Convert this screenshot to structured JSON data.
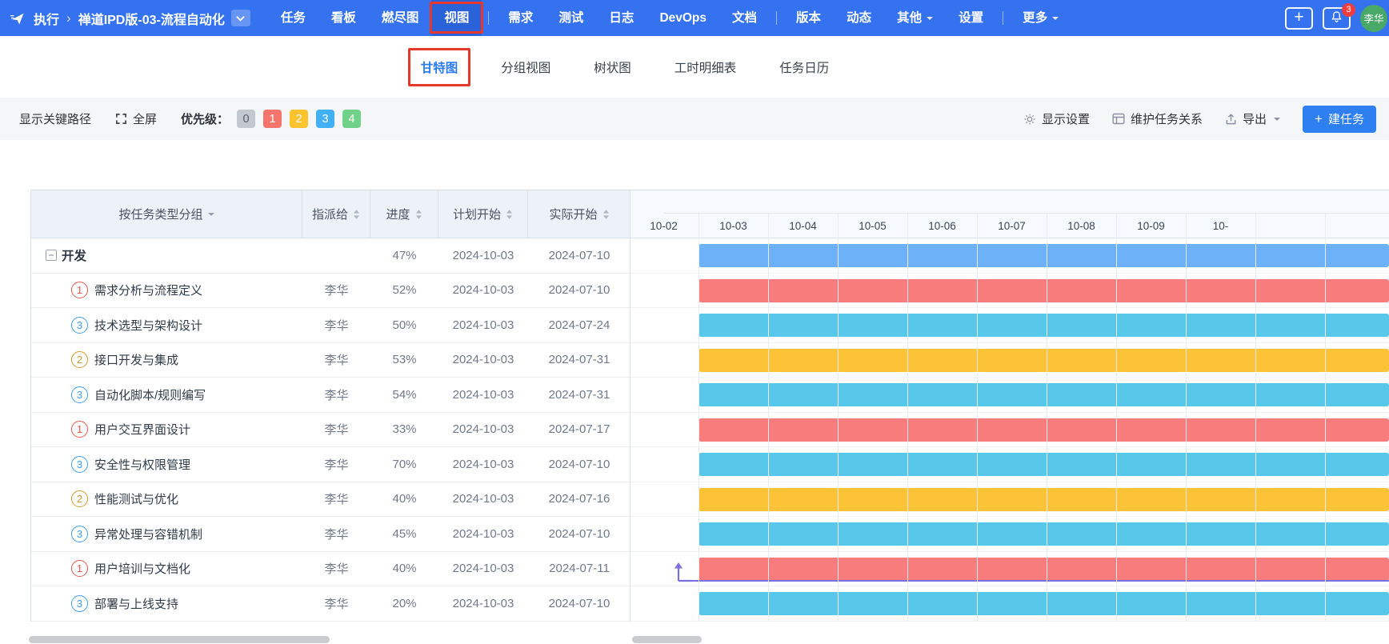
{
  "navbar": {
    "breadcrumb": {
      "section": "执行",
      "separator": "›",
      "project": "禅道IPD版-03-流程自动化"
    },
    "menu": [
      {
        "label": "任务"
      },
      {
        "label": "看板"
      },
      {
        "label": "燃尽图"
      },
      {
        "label": "视图",
        "active": true
      },
      {
        "divider": true
      },
      {
        "label": "需求"
      },
      {
        "label": "测试"
      },
      {
        "label": "日志"
      },
      {
        "label": "DevOps"
      },
      {
        "label": "文档"
      },
      {
        "divider": true
      },
      {
        "label": "版本"
      },
      {
        "label": "动态"
      },
      {
        "label": "其他",
        "caret": true
      },
      {
        "label": "设置"
      },
      {
        "divider": true
      },
      {
        "label": "更多",
        "caret": true
      }
    ],
    "plus_icon": "+",
    "notification_count": "3",
    "avatar_name": "李华"
  },
  "tabs": [
    {
      "label": "甘特图",
      "active": true
    },
    {
      "label": "分组视图"
    },
    {
      "label": "树状图"
    },
    {
      "label": "工时明细表"
    },
    {
      "label": "任务日历"
    }
  ],
  "toolbar": {
    "show_critical_path": "显示关键路径",
    "fullscreen": "全屏",
    "priority_label": "优先级：",
    "priorities": [
      {
        "label": "0",
        "bg": "#c2c7d0",
        "fg": "#595f6b"
      },
      {
        "label": "1",
        "bg": "#f3756c",
        "fg": "#ffffff"
      },
      {
        "label": "2",
        "bg": "#fcc32f",
        "fg": "#ffffff"
      },
      {
        "label": "3",
        "bg": "#41b0f5",
        "fg": "#ffffff"
      },
      {
        "label": "4",
        "bg": "#70d288",
        "fg": "#ffffff"
      }
    ],
    "display_settings": "显示设置",
    "maintain_relations": "维护任务关系",
    "export": "导出",
    "create_task_plus": "+",
    "create_task": "建任务"
  },
  "table": {
    "group_column": "按任务类型分组",
    "columns": [
      "指派给",
      "进度",
      "计划开始",
      "实际开始"
    ],
    "rows": [
      {
        "kind": "group",
        "name": "开发",
        "assignee": "",
        "progress": "47%",
        "plan_start": "2024-10-03",
        "actual_start": "2024-07-10",
        "bar": "blue"
      },
      {
        "kind": "task",
        "priority": "1",
        "name": "需求分析与流程定义",
        "assignee": "李华",
        "progress": "52%",
        "plan_start": "2024-10-03",
        "actual_start": "2024-07-10",
        "bar": "red"
      },
      {
        "kind": "task",
        "priority": "3",
        "name": "技术选型与架构设计",
        "assignee": "李华",
        "progress": "50%",
        "plan_start": "2024-10-03",
        "actual_start": "2024-07-24",
        "bar": "cyan"
      },
      {
        "kind": "task",
        "priority": "2",
        "name": "接口开发与集成",
        "assignee": "李华",
        "progress": "53%",
        "plan_start": "2024-10-03",
        "actual_start": "2024-07-31",
        "bar": "yellow"
      },
      {
        "kind": "task",
        "priority": "3",
        "name": "自动化脚本/规则编写",
        "assignee": "李华",
        "progress": "54%",
        "plan_start": "2024-10-03",
        "actual_start": "2024-07-31",
        "bar": "cyan"
      },
      {
        "kind": "task",
        "priority": "1",
        "name": "用户交互界面设计",
        "assignee": "李华",
        "progress": "33%",
        "plan_start": "2024-10-03",
        "actual_start": "2024-07-17",
        "bar": "red"
      },
      {
        "kind": "task",
        "priority": "3",
        "name": "安全性与权限管理",
        "assignee": "李华",
        "progress": "70%",
        "plan_start": "2024-10-03",
        "actual_start": "2024-07-10",
        "bar": "cyan"
      },
      {
        "kind": "task",
        "priority": "2",
        "name": "性能测试与优化",
        "assignee": "李华",
        "progress": "40%",
        "plan_start": "2024-10-03",
        "actual_start": "2024-07-16",
        "bar": "yellow"
      },
      {
        "kind": "task",
        "priority": "3",
        "name": "异常处理与容错机制",
        "assignee": "李华",
        "progress": "45%",
        "plan_start": "2024-10-03",
        "actual_start": "2024-07-10",
        "bar": "cyan"
      },
      {
        "kind": "task",
        "priority": "1",
        "name": "用户培训与文档化",
        "assignee": "李华",
        "progress": "40%",
        "plan_start": "2024-10-03",
        "actual_start": "2024-07-11",
        "bar": "red",
        "dependency": true
      },
      {
        "kind": "task",
        "priority": "3",
        "name": "部署与上线支持",
        "assignee": "李华",
        "progress": "20%",
        "plan_start": "2024-10-03",
        "actual_start": "2024-07-10",
        "bar": "cyan"
      }
    ],
    "priority_colors": {
      "1": "#e5564b",
      "2": "#d29a2d",
      "3": "#3d9ff2"
    }
  },
  "gantt": {
    "dates": [
      "10-02",
      "10-03",
      "10-04",
      "10-05",
      "10-06",
      "10-07",
      "10-08",
      "10-09",
      "10-"
    ],
    "bar_colors": {
      "blue": "#6db2f8",
      "red": "#f87c7c",
      "cyan": "#58c8ea",
      "yellow": "#fdc337"
    }
  },
  "colors": {
    "navbar_bg": "#3472ef",
    "navbar_active_bg": "#2a62da",
    "annotation_red": "#e5372c",
    "accent_blue": "#2e7ff2",
    "dependency_purple": "#7a6fe2"
  }
}
